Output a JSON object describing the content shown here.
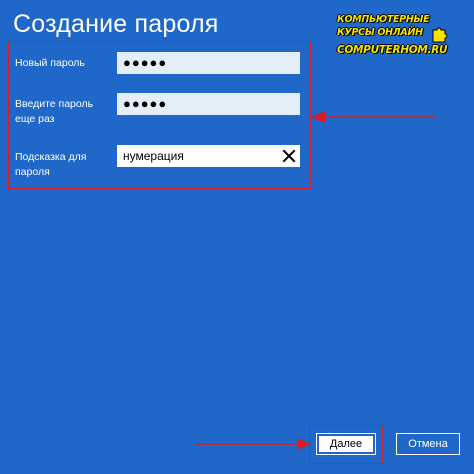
{
  "header": {
    "title": "Создание пароля"
  },
  "watermark": {
    "line1": "КОМПЬЮТЕРНЫЕ",
    "line2": "КУРСЫ   ОНЛАЙН",
    "line3": "COMPUTERHOM.RU",
    "icon": "puzzle-icon"
  },
  "form": {
    "new_password": {
      "label": "Новый пароль",
      "value": "●●●●●"
    },
    "confirm_password": {
      "label_line1": "Введите пароль",
      "label_line2": "еще раз",
      "value": "●●●●●"
    },
    "hint": {
      "label_line1": "Подсказка для",
      "label_line2": "пароля",
      "value": "нумерация",
      "clear_icon": "close-icon"
    }
  },
  "buttons": {
    "next_label": "Далее",
    "cancel_label": "Отмена"
  },
  "colors": {
    "background": "#1f67c8",
    "highlight": "#d81c24",
    "input_bg": "#e4eef7",
    "watermark": "#f7e200"
  }
}
